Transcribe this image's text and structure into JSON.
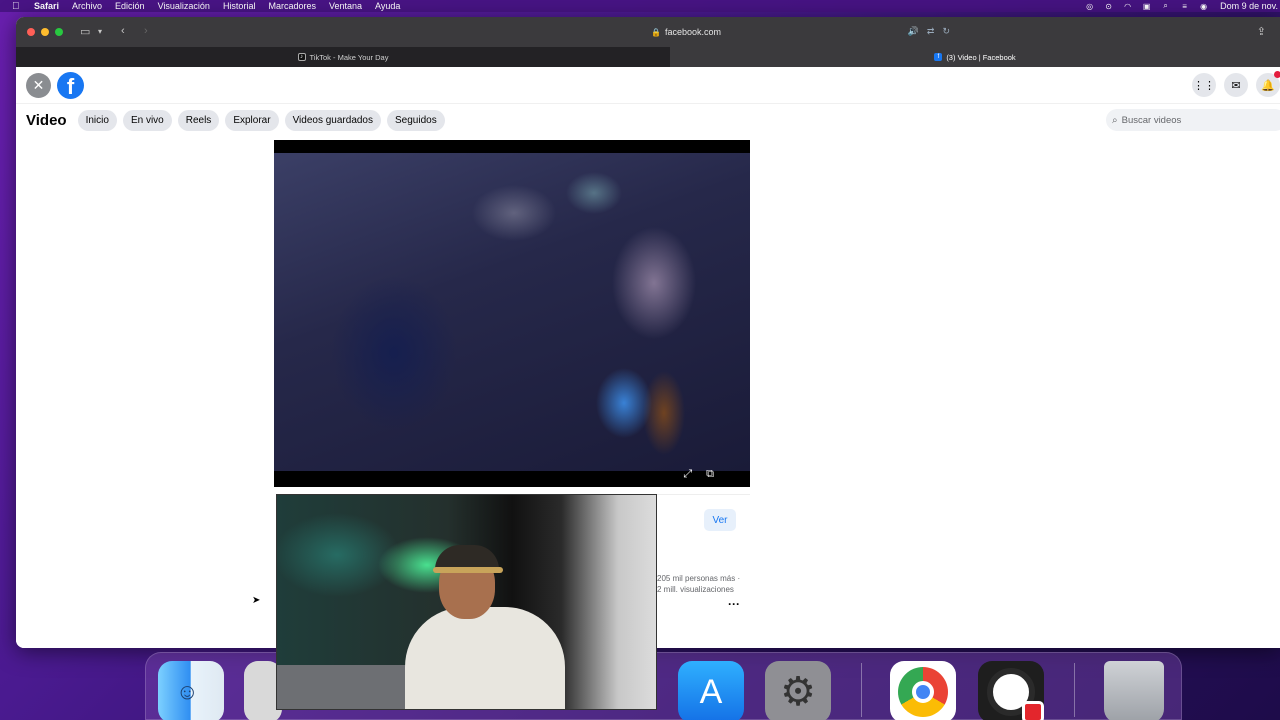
{
  "menubar": {
    "apple": "",
    "app_name": "Safari",
    "items": [
      "Archivo",
      "Edición",
      "Visualización",
      "Historial",
      "Marcadores",
      "Ventana",
      "Ayuda"
    ],
    "clock": "Dom 9 de nov."
  },
  "browser": {
    "address": "facebook.com",
    "tabs": [
      {
        "title": "TikTok - Make Your Day",
        "favicon": "tiktok-icon"
      },
      {
        "title": "(3) Video | Facebook",
        "favicon": "facebook-icon"
      }
    ]
  },
  "facebook": {
    "close_glyph": "✕",
    "logo_glyph": "f",
    "section_title": "Video",
    "nav_pills": [
      "Inicio",
      "En vivo",
      "Reels",
      "Explorar",
      "Videos guardados",
      "Seguidos"
    ],
    "search_placeholder": "Buscar videos",
    "ver_button": "Ver",
    "stat_followers": "205 mil personas más ·",
    "stat_views": "2 mill. visualizaciones",
    "more_glyph": "···"
  },
  "colors": {
    "fb_blue": "#1877f2",
    "notification_red": "#e41e3f",
    "pill_bg": "#e4e6eb"
  },
  "icons": {
    "menubar_right": [
      "siri-icon",
      "control-center-icon",
      "wifi-icon",
      "keyboard-input-icon",
      "spotlight-search-icon",
      "controls-icon",
      "screen-record-icon"
    ],
    "fb_right": [
      "apps-grid-icon",
      "messenger-icon",
      "notifications-bell-icon"
    ],
    "dock": [
      "finder-icon",
      "launchpad-icon",
      "app-store-icon",
      "system-settings-icon",
      "chrome-icon",
      "obs-icon",
      "trash-icon"
    ]
  }
}
